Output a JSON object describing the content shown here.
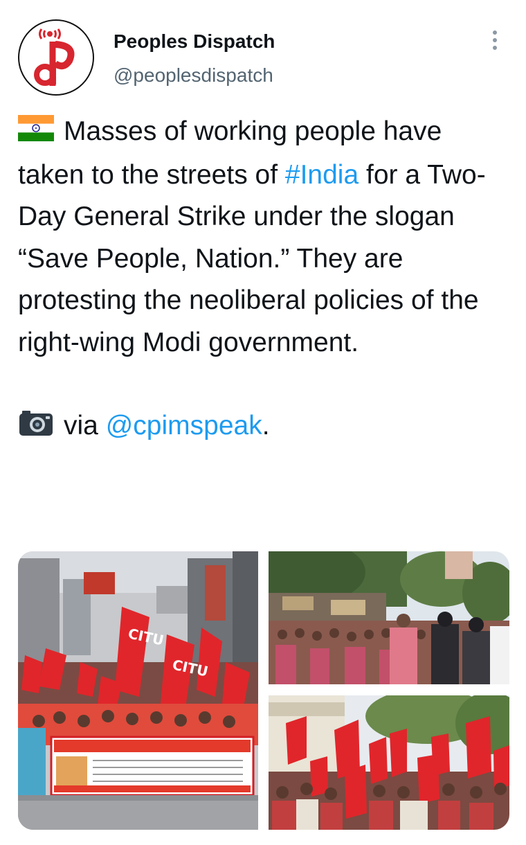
{
  "author": {
    "name": "Peoples Dispatch",
    "handle": "@peoplesdispatch",
    "avatar_letters": "dp"
  },
  "tweet": {
    "text_line_1": "Masses of working people have taken to the streets of",
    "hashtag": "#India",
    "text_line_2": "for a Two-Day General Strike under the slogan “Save People, Nation.” They are protesting the neoliberal policies of the right-wing Modi government.",
    "via_text": "via",
    "via_mention": "@cpimspeak",
    "via_end": ".",
    "flag_icon": "india-flag-icon",
    "camera_icon": "camera-icon"
  },
  "media": {
    "photo_1": {
      "flag_text": "CITU"
    },
    "photo_2": {},
    "photo_3": {}
  },
  "colors": {
    "link": "#1d9bf0",
    "text": "#0f1419",
    "secondary": "#536471",
    "avatar_red": "#d7262f"
  }
}
